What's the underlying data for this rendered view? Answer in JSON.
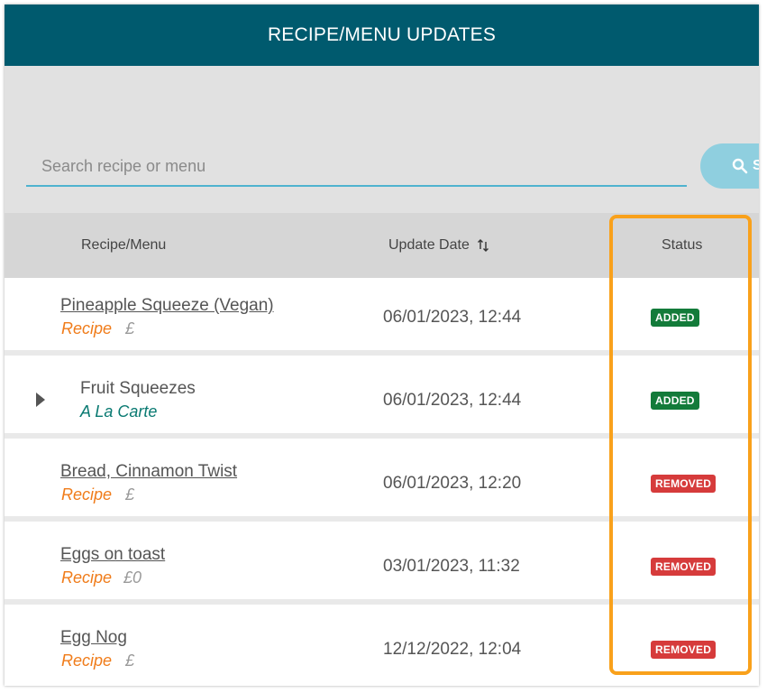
{
  "header": {
    "title": "RECIPE/MENU UPDATES"
  },
  "search": {
    "placeholder": "Search recipe or menu",
    "value": "",
    "button_label": "S"
  },
  "table": {
    "columns": {
      "recipe": "Recipe/Menu",
      "date": "Update Date",
      "status": "Status"
    },
    "rows": [
      {
        "name": "Pineapple Squeeze (Vegan)",
        "type": "Recipe",
        "price": "£",
        "date": "06/01/2023, 12:44",
        "status": "ADDED"
      },
      {
        "name": "Fruit Squeezes",
        "type": "A La Carte",
        "price": "",
        "date": "06/01/2023, 12:44",
        "status": "ADDED"
      },
      {
        "name": "Bread, Cinnamon Twist",
        "type": "Recipe",
        "price": "£",
        "date": "06/01/2023, 12:20",
        "status": "REMOVED"
      },
      {
        "name": "Eggs on toast",
        "type": "Recipe",
        "price": "£0",
        "date": "03/01/2023, 11:32",
        "status": "REMOVED"
      },
      {
        "name": "Egg Nog",
        "type": "Recipe",
        "price": "£",
        "date": "12/12/2022, 12:04",
        "status": "REMOVED"
      }
    ]
  },
  "colors": {
    "header_bg": "#005a6e",
    "accent": "#4fb3cf",
    "added": "#137b3a",
    "removed": "#d63b3b",
    "recipe_type": "#f07c1a",
    "menu_type": "#0a7a72",
    "highlight": "#f9a11b"
  },
  "icons": {
    "search": "search-icon",
    "sort": "sort-icon",
    "expand": "caret-right-icon"
  }
}
